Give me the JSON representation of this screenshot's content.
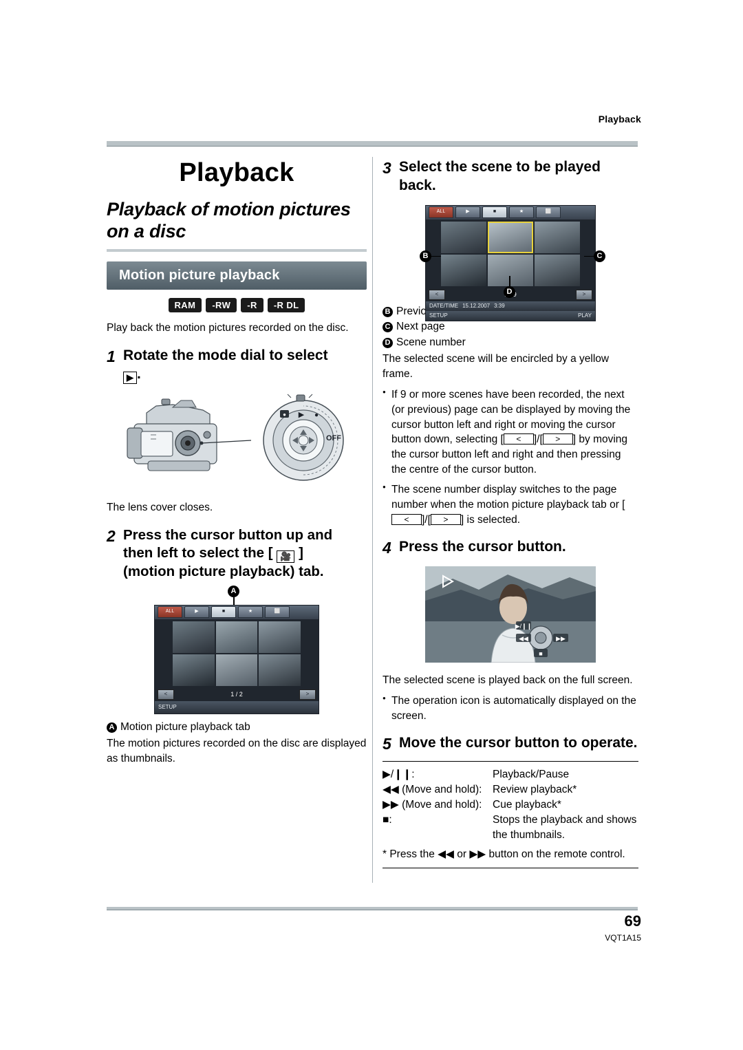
{
  "header": {
    "running_head": "Playback"
  },
  "left": {
    "chapter_title": "Playback",
    "section_title": "Playback of motion pictures on a disc",
    "subhead": "Motion picture playback",
    "badges": [
      "RAM",
      "-RW",
      "-R",
      "-R DL"
    ],
    "intro": "Play back the motion pictures recorded on the disc.",
    "step1": {
      "num": "1",
      "text_before": "Rotate the mode dial to select",
      "icon": "play-mode-icon",
      "text_after": "."
    },
    "lens_caption": "The lens cover closes.",
    "step2": {
      "num": "2",
      "line1": "Press the cursor button up and",
      "line2_before": "then left to select the [",
      "icon": "motion-picture-icon",
      "line2_after": "]",
      "line3": "(motion picture playback) tab."
    },
    "lcd2": {
      "marker": "A",
      "tabs": [
        "ALL",
        "▶",
        "■",
        "★",
        "⬜"
      ],
      "page_indicator": "1 / 2",
      "prev_arrow": "<",
      "next_arrow": ">",
      "bottom_left": "SETUP"
    },
    "legend_a_letter": "A",
    "legend_a_text": "Motion picture playback tab",
    "legend_a_desc": "The motion pictures recorded on the disc are displayed as thumbnails."
  },
  "right": {
    "step3": {
      "num": "3",
      "text": "Select the scene to be played back."
    },
    "lcd3": {
      "tabs": [
        "ALL",
        "▶",
        "■",
        "★",
        "⬜"
      ],
      "page_indicator": "1 / 9",
      "prev_arrow": "<",
      "next_arrow": ">",
      "marker_b": "B",
      "marker_c": "C",
      "marker_d": "D",
      "datetime_label": "DATE/TIME",
      "datetime_value": "15.12.2007",
      "time_value": "3:39",
      "bottom_left": "SETUP",
      "bottom_right": "PLAY"
    },
    "legend": [
      {
        "letter": "B",
        "text": "Previous page"
      },
      {
        "letter": "C",
        "text": "Next page"
      },
      {
        "letter": "D",
        "text": "Scene number"
      }
    ],
    "legend_desc": "The selected scene will be encircled by a yellow frame.",
    "bullets": [
      {
        "seg1": "If 9 or more scenes have been recorded, the next (or previous) page can be displayed by moving the cursor button left and right or moving the cursor button down, selecting [",
        "key1": "<",
        "seg2": "]/[",
        "key2": ">",
        "seg3": "] by moving the cursor button left and right and then pressing the centre of the cursor button."
      },
      {
        "seg1": "The scene number display switches to the page number when the motion picture playback tab or [",
        "key1": "<",
        "seg2": "]/[",
        "key2": ">",
        "seg3": "] is selected."
      }
    ],
    "step4": {
      "num": "4",
      "text": "Press the cursor button."
    },
    "step4_caption": "The selected scene is played back on the full screen.",
    "step4_bullet": "The operation icon is automatically displayed on the screen.",
    "step5": {
      "num": "5",
      "text": "Move the cursor button to operate."
    },
    "op_rows": [
      {
        "key": "▶/❙❙:",
        "value": "Playback/Pause"
      },
      {
        "key": "◀◀ (Move and hold):",
        "value": "Review playback*"
      },
      {
        "key": "▶▶ (Move and hold):",
        "value": "Cue playback*"
      },
      {
        "key": "■:",
        "value": "Stops the playback and shows the thumbnails."
      }
    ],
    "op_note_pre": "* Press the ",
    "op_note_rev": "◀◀",
    "op_note_mid": " or ",
    "op_note_cue": "▶▶",
    "op_note_post": " button on the remote control."
  },
  "footer": {
    "page_number": "69",
    "doc_id": "VQT1A15"
  },
  "colors": {
    "rule": "#b9c2c6",
    "subhead_bg": "#5b6a72",
    "badge_bg": "#1b1b1b"
  }
}
